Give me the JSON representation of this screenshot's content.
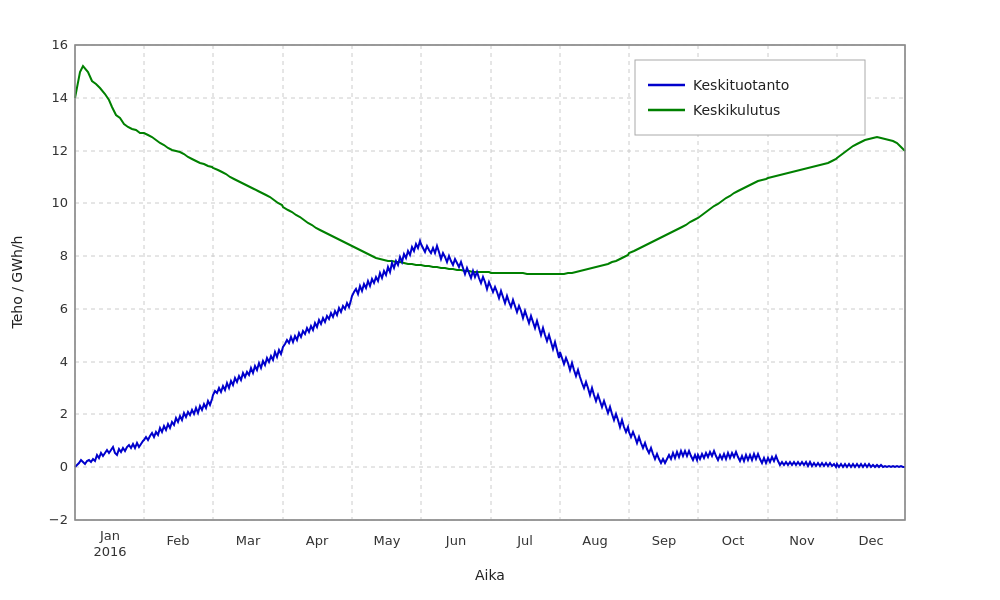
{
  "chart": {
    "title": "",
    "x_axis_label": "Aika",
    "y_axis_label": "Teho / GWh/h",
    "y_min": -2,
    "y_max": 16,
    "x_months": [
      "Jan\n2016",
      "Feb",
      "Mar",
      "Apr",
      "May",
      "Jun",
      "Jul",
      "Aug",
      "Sep",
      "Oct",
      "Nov",
      "Dec"
    ],
    "legend": [
      {
        "label": "Keskituotanto",
        "color": "#0000cc"
      },
      {
        "label": "Keskikulutus",
        "color": "#008000"
      }
    ]
  }
}
